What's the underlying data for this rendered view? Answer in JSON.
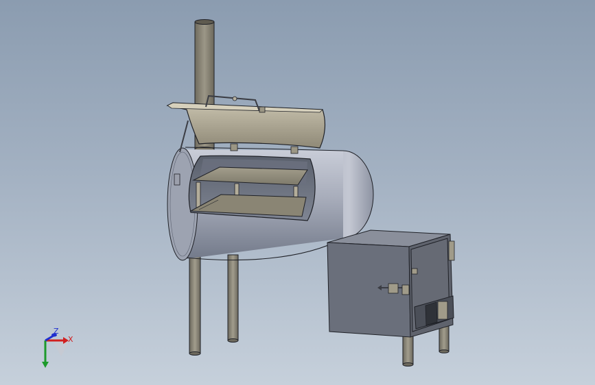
{
  "viewport": {
    "background_top": "#8b9cb0",
    "background_bottom": "#c6d0db"
  },
  "model": {
    "parts": [
      "smokestack",
      "lid",
      "lid-handle",
      "cooking-chamber",
      "cooking-grate",
      "legs",
      "firebox",
      "firebox-door",
      "door-latch",
      "air-vent"
    ],
    "colors": {
      "metal_light": "#bcc1cd",
      "metal_mid": "#8e94a4",
      "metal_dark": "#5d6372",
      "firebox_front": "#6a6f7b",
      "firebox_side": "#5e626c",
      "stack": "#8f8a7a",
      "lid": "#b2ab98",
      "outline": "#1e2026"
    }
  },
  "triad": {
    "x_label": "X",
    "y_label": "Y",
    "z_label": "Z",
    "x_color": "#d11f1f",
    "y_color": "#1c9a2b",
    "z_color": "#1f2fcf"
  }
}
